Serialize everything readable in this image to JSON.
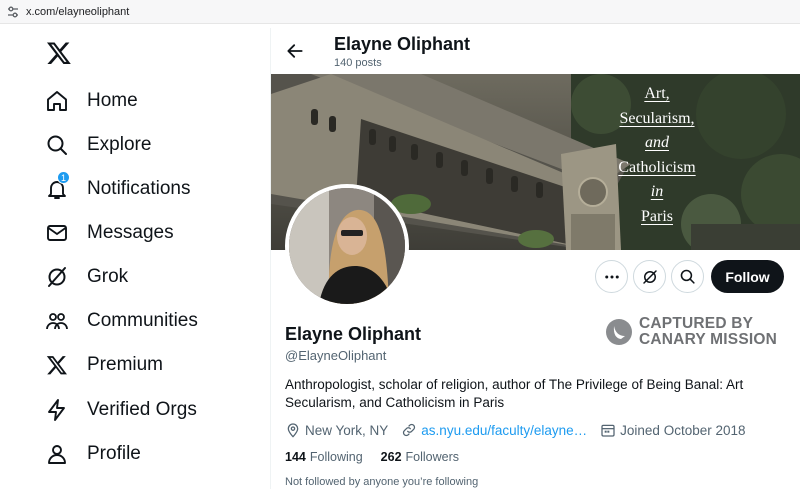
{
  "browser": {
    "url": "x.com/elayneoliphant"
  },
  "sidebar": {
    "items": [
      {
        "label": "Home",
        "icon": "home-icon"
      },
      {
        "label": "Explore",
        "icon": "search-icon"
      },
      {
        "label": "Notifications",
        "icon": "bell-icon",
        "badge": "1"
      },
      {
        "label": "Messages",
        "icon": "envelope-icon"
      },
      {
        "label": "Grok",
        "icon": "grok-icon"
      },
      {
        "label": "Communities",
        "icon": "people-icon"
      },
      {
        "label": "Premium",
        "icon": "x-logo-icon"
      },
      {
        "label": "Verified Orgs",
        "icon": "lightning-icon"
      },
      {
        "label": "Profile",
        "icon": "person-icon"
      }
    ]
  },
  "header": {
    "name": "Elayne Oliphant",
    "posts": "140 posts"
  },
  "banner": {
    "lines": [
      "Art,",
      "Secularism,",
      "and",
      "Catholicism",
      "in",
      "Paris"
    ]
  },
  "profile": {
    "name": "Elayne Oliphant",
    "handle": "@ElayneOliphant",
    "bio": "Anthropologist, scholar of religion, author of The Privilege of Being Banal: Art Secularism, and Catholicism in Paris",
    "location": "New York, NY",
    "website": "as.nyu.edu/faculty/elayne…",
    "joined": "Joined October 2018",
    "following_count": "144",
    "following_label": "Following",
    "followers_count": "262",
    "followers_label": "Followers",
    "not_followed": "Not followed by anyone you’re following"
  },
  "actions": {
    "follow_label": "Follow"
  },
  "watermark": {
    "line1": "CAPTURED BY",
    "line2": "CANARY MISSION"
  },
  "colors": {
    "accent": "#1d9bf0",
    "text": "#0f1419",
    "secondary": "#536471"
  }
}
